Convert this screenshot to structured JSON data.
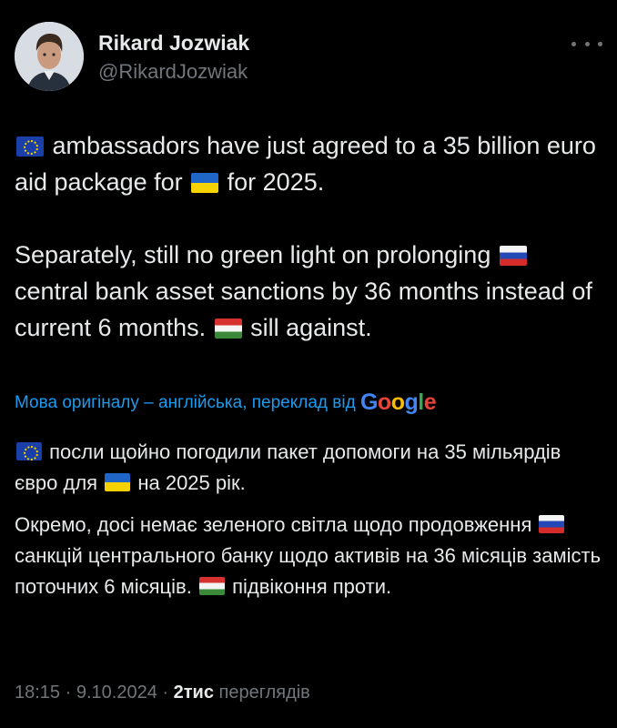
{
  "author": {
    "name": "Rikard Jozwiak",
    "handle": "@RikardJozwiak"
  },
  "tweet": {
    "p1_a": "ambassadors have just agreed to a 35 billion euro aid package for",
    "p1_b": "for 2025.",
    "p2_a": "Separately, still no green light on prolonging",
    "p2_b": "central bank asset sanctions by 36 months instead of current 6 months.",
    "p2_c": "sill against."
  },
  "translation": {
    "label": "Мова оригіналу – англійська, переклад від",
    "provider": "Google",
    "p1_a": "посли щойно погодили пакет допомоги на 35 мільярдів євро для",
    "p1_b": "на 2025 рік.",
    "p2_a": "Окремо, досі немає зеленого світла щодо продовження",
    "p2_b": "санкцій центрального банку щодо активів на 36 місяців замість поточних 6 місяців.",
    "p2_c": "підвіконня проти."
  },
  "footer": {
    "time": "18:15",
    "date": "9.10.2024",
    "views_count": "2тис",
    "views_label": "переглядів"
  },
  "colors": {
    "background": "#000000",
    "text": "#e7e9ea",
    "muted": "#71767b",
    "link": "#1d9bf0"
  },
  "icons": {
    "more": "more-horizontal-icon",
    "flags": [
      "eu-flag",
      "ukraine-flag",
      "russia-flag",
      "hungary-flag"
    ]
  }
}
